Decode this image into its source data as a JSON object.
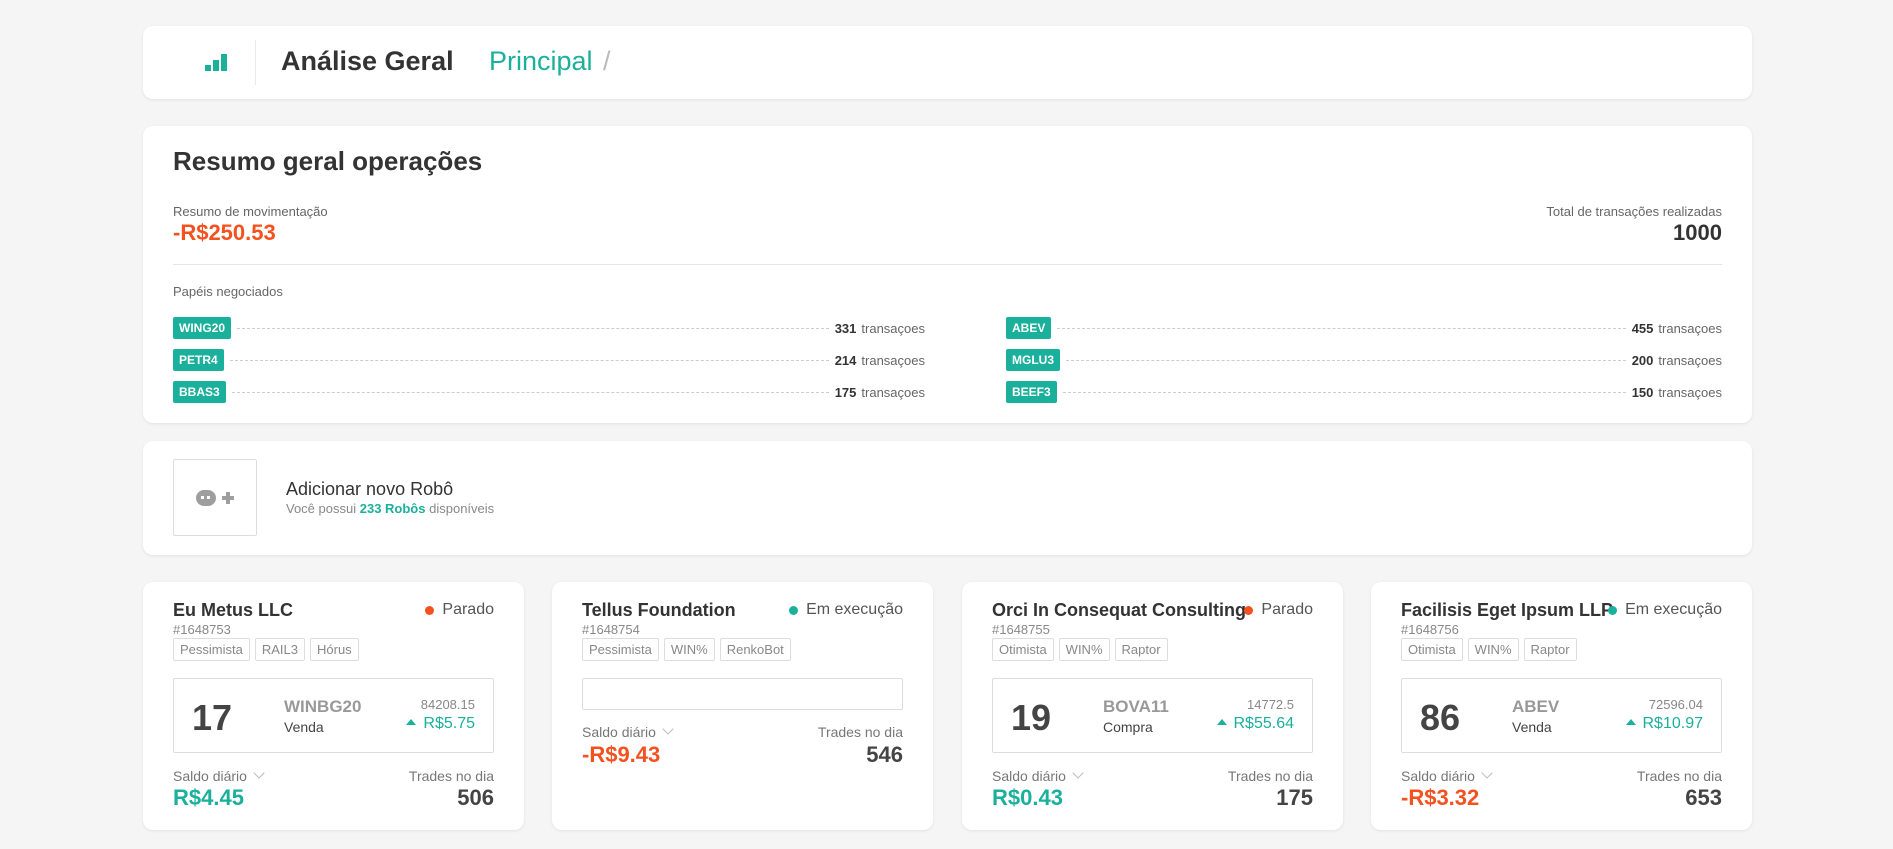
{
  "header": {
    "logo_icon": "bar-chart-icon",
    "title": "Análise Geral",
    "separator": "/",
    "breadcrumb": "Principal"
  },
  "resumo": {
    "title": "Resumo geral operações",
    "movimentacao_label": "Resumo de movimentação",
    "movimentacao_value": "-R$250.53",
    "total_label": "Total de transações realizadas",
    "total_value": "1000",
    "papeis_label": "Papéis negociados",
    "unit": "transaçoes",
    "papeis": [
      {
        "ticker": "WING20",
        "count": "331"
      },
      {
        "ticker": "PETR4",
        "count": "214"
      },
      {
        "ticker": "BBAS3",
        "count": "175"
      },
      {
        "ticker": "ABEV",
        "count": "455"
      },
      {
        "ticker": "MGLU3",
        "count": "200"
      },
      {
        "ticker": "BEEF3",
        "count": "150"
      }
    ]
  },
  "add_robot": {
    "icon": "robot-add-icon",
    "title": "Adicionar novo Robô",
    "subtitle_prefix": "Você possui",
    "subtitle_count": "233 Robôs",
    "subtitle_suffix": "disponíveis"
  },
  "labels": {
    "saldo": "Saldo diário",
    "trades": "Trades no dia"
  },
  "colors": {
    "accent": "#1bb09b",
    "negative": "#f4511e"
  },
  "robots": [
    {
      "name": "Eu Metus LLC",
      "status": "Parado",
      "status_color": "#f4511e",
      "id": "#1648753",
      "tags": [
        "Pessimista",
        "RAIL3",
        "Hórus"
      ],
      "qty": "17",
      "ticker": "WINBG20",
      "side": "Venda",
      "price": "84208.15",
      "change": "R$5.75",
      "saldo": "R$4.45",
      "trades": "506"
    },
    {
      "name": "Tellus Foundation",
      "status": "Em execução",
      "status_color": "#1bb09b",
      "id": "#1648754",
      "tags": [
        "Pessimista",
        "WIN%",
        "RenkoBot"
      ],
      "saldo": "-R$9.43",
      "trades": "546"
    },
    {
      "name": "Orci In Consequat Consulting",
      "status": "Parado",
      "status_color": "#f4511e",
      "id": "#1648755",
      "tags": [
        "Otimista",
        "WIN%",
        "Raptor"
      ],
      "qty": "19",
      "ticker": "BOVA11",
      "side": "Compra",
      "price": "14772.5",
      "change": "R$55.64",
      "saldo": "R$0.43",
      "trades": "175"
    },
    {
      "name": "Facilisis Eget Ipsum LLP",
      "status": "Em execução",
      "status_color": "#1bb09b",
      "id": "#1648756",
      "tags": [
        "Otimista",
        "WIN%",
        "Raptor"
      ],
      "qty": "86",
      "ticker": "ABEV",
      "side": "Venda",
      "price": "72596.04",
      "change": "R$10.97",
      "saldo": "-R$3.32",
      "trades": "653"
    }
  ]
}
